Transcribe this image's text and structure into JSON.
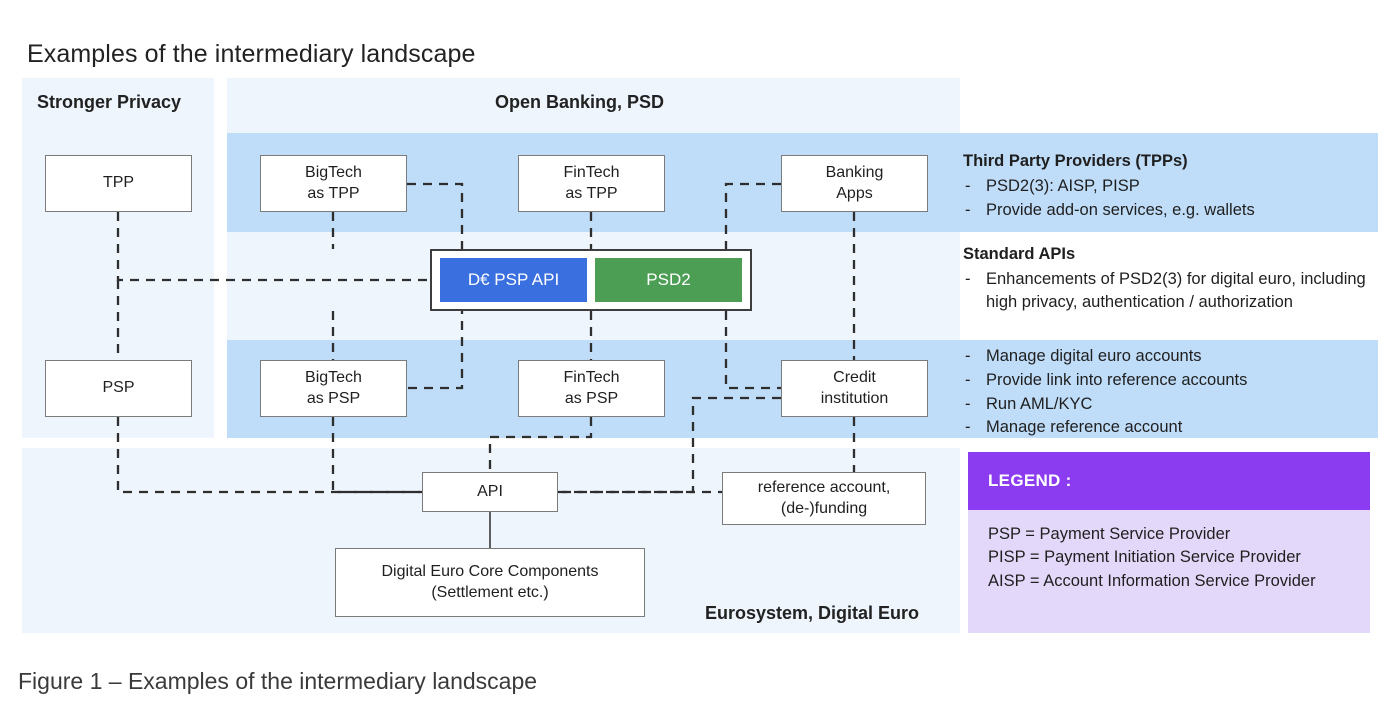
{
  "page": {
    "title": "Examples of the intermediary landscape",
    "caption": "Figure 1 – Examples of the intermediary landscape"
  },
  "panels": {
    "privacy": {
      "heading": "Stronger Privacy"
    },
    "open_banking": {
      "heading": "Open Banking, PSD"
    },
    "eurosystem": {
      "heading": "Eurosystem, Digital Euro"
    }
  },
  "nodes": {
    "tpp": "TPP",
    "psp": "PSP",
    "bigtech_tpp": "BigTech\nas TPP",
    "fintech_tpp": "FinTech\nas TPP",
    "banking_apps": "Banking\nApps",
    "bigtech_psp": "BigTech\nas PSP",
    "fintech_psp": "FinTech\nas PSP",
    "credit_institution": "Credit\ninstitution",
    "api": "API",
    "reference_account": "reference account,\n(de-)funding",
    "core_components": "Digital Euro Core Components\n(Settlement etc.)"
  },
  "api_container": {
    "chips": [
      {
        "label": "D€ PSP API",
        "color": "#3a6fe0"
      },
      {
        "label": "PSD2",
        "color": "#4d9e55"
      }
    ]
  },
  "annotations": {
    "tpp": {
      "title": "Third Party Providers (TPPs)",
      "items": [
        "PSD2(3): AISP, PISP",
        "Provide add-on services, e.g. wallets"
      ]
    },
    "api": {
      "title": "Standard APIs",
      "items": [
        "Enhancements of PSD2(3) for digital euro, including high privacy, authentication / authorization"
      ]
    },
    "psp": {
      "title": "",
      "items": [
        "Manage digital euro accounts",
        "Provide link into reference accounts",
        "Run AML/KYC",
        "Manage reference account"
      ]
    }
  },
  "legend": {
    "header": "LEGEND :",
    "entries": [
      "PSP = Payment Service Provider",
      "PISP = Payment Initiation Service Provider",
      "AISP = Account Information Service Provider"
    ]
  },
  "colors": {
    "panel_background": "#eef5fd",
    "band_background": "#bfdcf8",
    "legend_header": "#8b3cf0",
    "legend_body": "#e4d8fa",
    "api_blue": "#3a6fe0",
    "api_green": "#4d9e55",
    "node_border": "#7b7b7b",
    "wire": "#2e2e2e"
  },
  "bullet_dash": "-"
}
